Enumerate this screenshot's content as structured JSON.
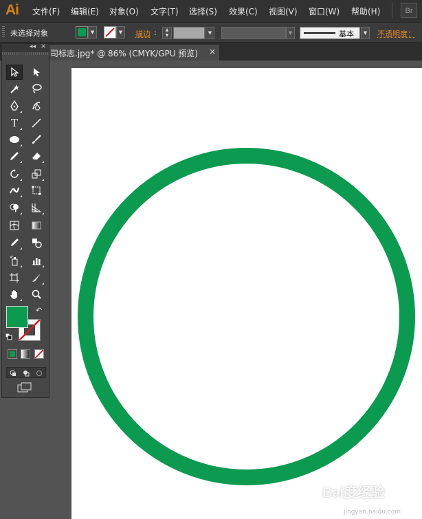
{
  "app": {
    "logo": "Ai",
    "bridge": "Br"
  },
  "menu": [
    "文件(F)",
    "编辑(E)",
    "对象(O)",
    "文字(T)",
    "选择(S)",
    "效果(C)",
    "视图(V)",
    "窗口(W)",
    "帮助(H)"
  ],
  "control_bar": {
    "selection": "未选择对象",
    "fill_color": "#0b9a4f",
    "stroke_label": "描边",
    "stroke_colon": ":",
    "brush_label": "基本",
    "opacity_label": "不透明度："
  },
  "document": {
    "tab_title": "司标志.jpg* @ 86% (CMYK/GPU 预览)",
    "close": "×"
  },
  "toolbox": {
    "collapse": "◂◂",
    "close": "×"
  },
  "artwork": {
    "circle_color": "#0b9a4f"
  },
  "watermark": {
    "text": "Bai度经验",
    "sub": "jingyan.baidu.com"
  },
  "colors": {
    "accent": "#d4821f",
    "stroke_label": "#e08a2b",
    "fill": "#0b9a4f"
  }
}
